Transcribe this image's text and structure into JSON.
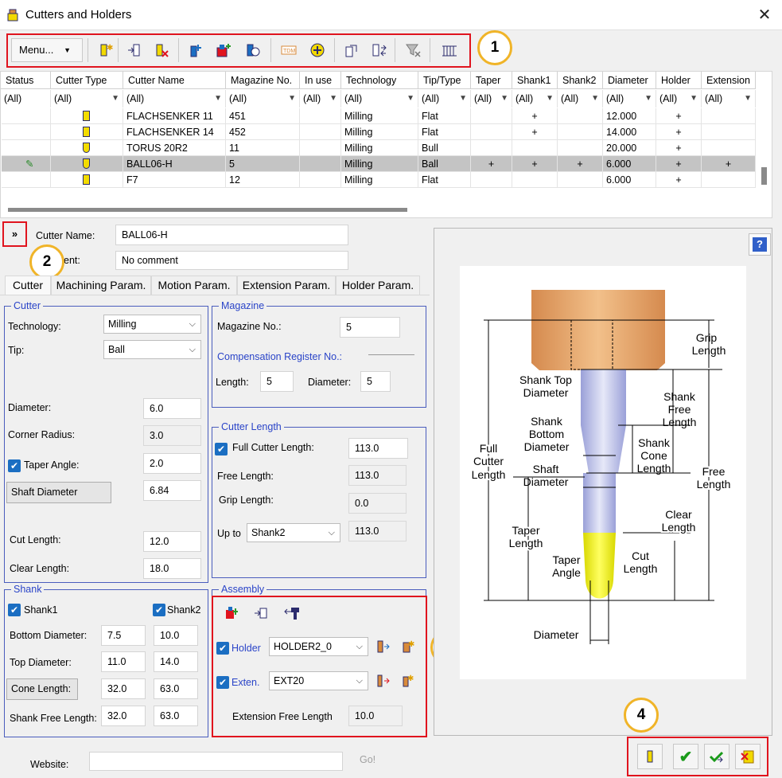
{
  "window": {
    "title": "Cutters and Holders"
  },
  "toolbar": {
    "menu_label": "Menu..."
  },
  "markers": [
    "1",
    "2",
    "3",
    "4"
  ],
  "grid": {
    "columns": [
      "Status",
      "Cutter Type",
      "Cutter Name",
      "Magazine No.",
      "In use",
      "Technology",
      "Tip/Type",
      "Taper",
      "Shank1",
      "Shank2",
      "Diameter",
      "Holder",
      "Extension"
    ],
    "filters": [
      "(All)",
      "(All)",
      "(All)",
      "(All)",
      "(All)",
      "(All)",
      "(All)",
      "(All)",
      "(All)",
      "(All)",
      "(All)",
      "(All)",
      "(All)"
    ],
    "rows": [
      {
        "name": "FLACHSENKER 11",
        "magazine": "451",
        "technology": "Milling",
        "tip": "Flat",
        "taper": "",
        "shank1": "+",
        "shank2": "",
        "diameter": "12.000",
        "holder": "+",
        "extension": ""
      },
      {
        "name": "FLACHSENKER 14",
        "magazine": "452",
        "technology": "Milling",
        "tip": "Flat",
        "taper": "",
        "shank1": "+",
        "shank2": "",
        "diameter": "14.000",
        "holder": "+",
        "extension": ""
      },
      {
        "name": "TORUS 20R2",
        "magazine": "11",
        "technology": "Milling",
        "tip": "Bull",
        "taper": "",
        "shank1": "",
        "shank2": "",
        "diameter": "20.000",
        "holder": "+",
        "extension": ""
      },
      {
        "name": "BALL06-H",
        "magazine": "5",
        "technology": "Milling",
        "tip": "Ball",
        "taper": "+",
        "shank1": "+",
        "shank2": "+",
        "diameter": "6.000",
        "holder": "+",
        "extension": "+"
      },
      {
        "name": "F7",
        "magazine": "12",
        "technology": "Milling",
        "tip": "Flat",
        "taper": "",
        "shank1": "",
        "shank2": "",
        "diameter": "6.000",
        "holder": "+",
        "extension": ""
      }
    ]
  },
  "header_fields": {
    "cutter_name_label": "Cutter Name:",
    "cutter_name": "BALL06-H",
    "comment_label": "ent:",
    "comment": "No comment"
  },
  "tabs": [
    "Cutter",
    "Machining Param.",
    "Motion Param.",
    "Extension Param.",
    "Holder Param."
  ],
  "cutter_group": {
    "title": "Cutter",
    "technology_label": "Technology:",
    "technology": "Milling",
    "tip_label": "Tip:",
    "tip": "Ball",
    "diameter_label": "Diameter:",
    "diameter": "6.0",
    "corner_radius_label": "Corner Radius:",
    "corner_radius": "3.0",
    "taper_angle_label": "Taper Angle:",
    "taper_angle": "2.0",
    "shaft_diameter_label": "Shaft Diameter",
    "shaft_diameter": "6.84",
    "cut_length_label": "Cut Length:",
    "cut_length": "12.0",
    "clear_length_label": "Clear Length:",
    "clear_length": "18.0"
  },
  "magazine_group": {
    "title": "Magazine",
    "magazine_no_label": "Magazine No.:",
    "magazine_no": "5",
    "comp_label": "Compensation Register No.:",
    "length_label": "Length:",
    "length": "5",
    "diameter_label": "Diameter:",
    "diameter": "5"
  },
  "length_group": {
    "title": "Cutter Length",
    "full_label": "Full Cutter Length:",
    "full": "113.0",
    "free_label": "Free Length:",
    "free": "113.0",
    "grip_label": "Grip Length:",
    "grip": "0.0",
    "upto_label": "Up to",
    "upto": "Shank2",
    "upto_value": "113.0"
  },
  "shank_group": {
    "title": "Shank",
    "shank1": "Shank1",
    "shank2": "Shank2",
    "bottom_label": "Bottom Diameter:",
    "bottom": [
      "7.5",
      "10.0"
    ],
    "top_label": "Top Diameter:",
    "top": [
      "11.0",
      "14.0"
    ],
    "cone_label": "Cone Length:",
    "cone": [
      "32.0",
      "63.0"
    ],
    "free_label": "Shank Free Length:",
    "free": [
      "32.0",
      "63.0"
    ]
  },
  "assembly_group": {
    "title": "Assembly",
    "holder_label": "Holder",
    "holder": "HOLDER2_0",
    "ext_label": "Exten.",
    "ext": "EXT20",
    "ext_free_label": "Extension Free Length",
    "ext_free": "10.0"
  },
  "website": {
    "label": "Website:",
    "value": "",
    "go": "Go!"
  },
  "diagram": {
    "help": "?",
    "labels": [
      "Grip Length",
      "Shank Top Diameter",
      "Shank Free Length",
      "Shank Bottom Diameter",
      "Shank Cone Length",
      "Full Cutter Length",
      "Shaft Diameter",
      "Free Length",
      "Clear Length",
      "Taper Length",
      "Taper Angle",
      "Cut Length",
      "Diameter"
    ]
  },
  "colors": {
    "accent_red": "#e0141e",
    "marker": "#f0b428",
    "group_title": "#2a44c8",
    "holder": "#e0a472",
    "shank": "#c8ccec",
    "tip": "#f2f20e"
  }
}
